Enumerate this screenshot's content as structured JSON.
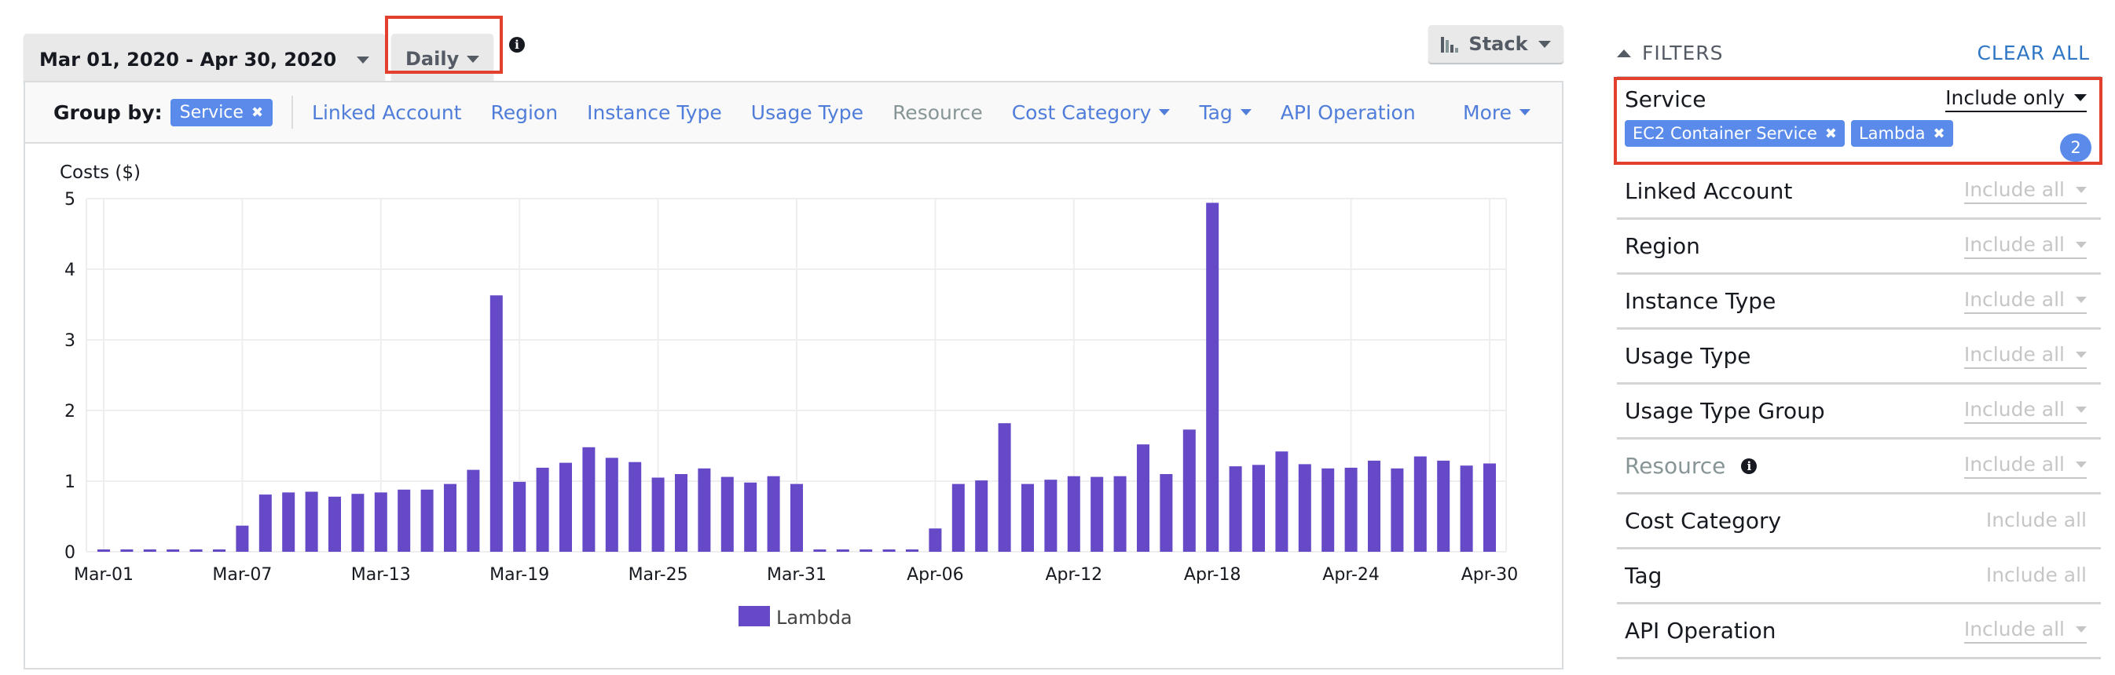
{
  "toolbar": {
    "date_range": "Mar 01, 2020 - Apr 30, 2020",
    "granularity": "Daily",
    "chart_style": "Stack",
    "info_icon": "info-icon"
  },
  "group_by": {
    "label": "Group by:",
    "selected_chip": "Service",
    "options": [
      {
        "label": "Linked Account",
        "enabled": true,
        "dropdown": false
      },
      {
        "label": "Region",
        "enabled": true,
        "dropdown": false
      },
      {
        "label": "Instance Type",
        "enabled": true,
        "dropdown": false
      },
      {
        "label": "Usage Type",
        "enabled": true,
        "dropdown": false
      },
      {
        "label": "Resource",
        "enabled": false,
        "dropdown": false
      },
      {
        "label": "Cost Category",
        "enabled": true,
        "dropdown": true
      },
      {
        "label": "Tag",
        "enabled": true,
        "dropdown": true
      },
      {
        "label": "API Operation",
        "enabled": true,
        "dropdown": false
      }
    ],
    "more_label": "More"
  },
  "filters": {
    "title": "FILTERS",
    "clear_all": "CLEAR ALL",
    "service": {
      "label": "Service",
      "mode": "Include only",
      "chips": [
        "EC2 Container Service",
        "Lambda"
      ],
      "count": "2"
    },
    "rows": [
      {
        "label": "Linked Account",
        "value": "Include all",
        "dropdown": true,
        "dim": false
      },
      {
        "label": "Region",
        "value": "Include all",
        "dropdown": true,
        "dim": false
      },
      {
        "label": "Instance Type",
        "value": "Include all",
        "dropdown": true,
        "dim": false
      },
      {
        "label": "Usage Type",
        "value": "Include all",
        "dropdown": true,
        "dim": false
      },
      {
        "label": "Usage Type Group",
        "value": "Include all",
        "dropdown": true,
        "dim": false
      },
      {
        "label": "Resource",
        "value": "Include all",
        "dropdown": true,
        "dim": true,
        "info": true
      },
      {
        "label": "Cost Category",
        "value": "Include all",
        "dropdown": false,
        "dim": false
      },
      {
        "label": "Tag",
        "value": "Include all",
        "dropdown": false,
        "dim": false
      },
      {
        "label": "API Operation",
        "value": "Include all",
        "dropdown": true,
        "dim": false
      }
    ]
  },
  "colors": {
    "bar": "#6549c7",
    "accent_blue": "#5a8bea",
    "link_blue": "#4f7dd9",
    "highlight_red": "#e2402c"
  },
  "chart_data": {
    "type": "bar",
    "title": "",
    "ylabel": "Costs ($)",
    "xlabel": "",
    "ylim": [
      0,
      5
    ],
    "yticks": [
      0,
      1,
      2,
      3,
      4,
      5
    ],
    "grid": true,
    "legend_position": "bottom-center",
    "x_tick_labels": [
      "Mar-01",
      "Mar-07",
      "Mar-13",
      "Mar-19",
      "Mar-25",
      "Mar-31",
      "Apr-06",
      "Apr-12",
      "Apr-18",
      "Apr-24",
      "Apr-30"
    ],
    "x_tick_every": 6,
    "categories": [
      "Mar-01",
      "Mar-02",
      "Mar-03",
      "Mar-04",
      "Mar-05",
      "Mar-06",
      "Mar-07",
      "Mar-08",
      "Mar-09",
      "Mar-10",
      "Mar-11",
      "Mar-12",
      "Mar-13",
      "Mar-14",
      "Mar-15",
      "Mar-16",
      "Mar-17",
      "Mar-18",
      "Mar-19",
      "Mar-20",
      "Mar-21",
      "Mar-22",
      "Mar-23",
      "Mar-24",
      "Mar-25",
      "Mar-26",
      "Mar-27",
      "Mar-28",
      "Mar-29",
      "Mar-30",
      "Mar-31",
      "Apr-01",
      "Apr-02",
      "Apr-03",
      "Apr-04",
      "Apr-05",
      "Apr-06",
      "Apr-07",
      "Apr-08",
      "Apr-09",
      "Apr-10",
      "Apr-11",
      "Apr-12",
      "Apr-13",
      "Apr-14",
      "Apr-15",
      "Apr-16",
      "Apr-17",
      "Apr-18",
      "Apr-19",
      "Apr-20",
      "Apr-21",
      "Apr-22",
      "Apr-23",
      "Apr-24",
      "Apr-25",
      "Apr-26",
      "Apr-27",
      "Apr-28",
      "Apr-29",
      "Apr-30"
    ],
    "series": [
      {
        "name": "Lambda",
        "color": "#6549c7",
        "values": [
          0.01,
          0.01,
          0.01,
          0.01,
          0.01,
          0.01,
          0.37,
          0.81,
          0.84,
          0.85,
          0.78,
          0.82,
          0.84,
          0.88,
          0.88,
          0.96,
          1.16,
          3.63,
          0.99,
          1.19,
          1.26,
          1.48,
          1.33,
          1.27,
          1.05,
          1.1,
          1.18,
          1.06,
          0.98,
          1.07,
          0.96,
          0.01,
          0.01,
          0.01,
          0.01,
          0.01,
          0.33,
          0.96,
          1.01,
          1.82,
          0.96,
          1.02,
          1.07,
          1.06,
          1.07,
          1.52,
          1.1,
          1.73,
          4.94,
          1.21,
          1.23,
          1.42,
          1.24,
          1.18,
          1.19,
          1.29,
          1.18,
          1.35,
          1.29,
          1.22,
          1.25
        ]
      }
    ]
  }
}
